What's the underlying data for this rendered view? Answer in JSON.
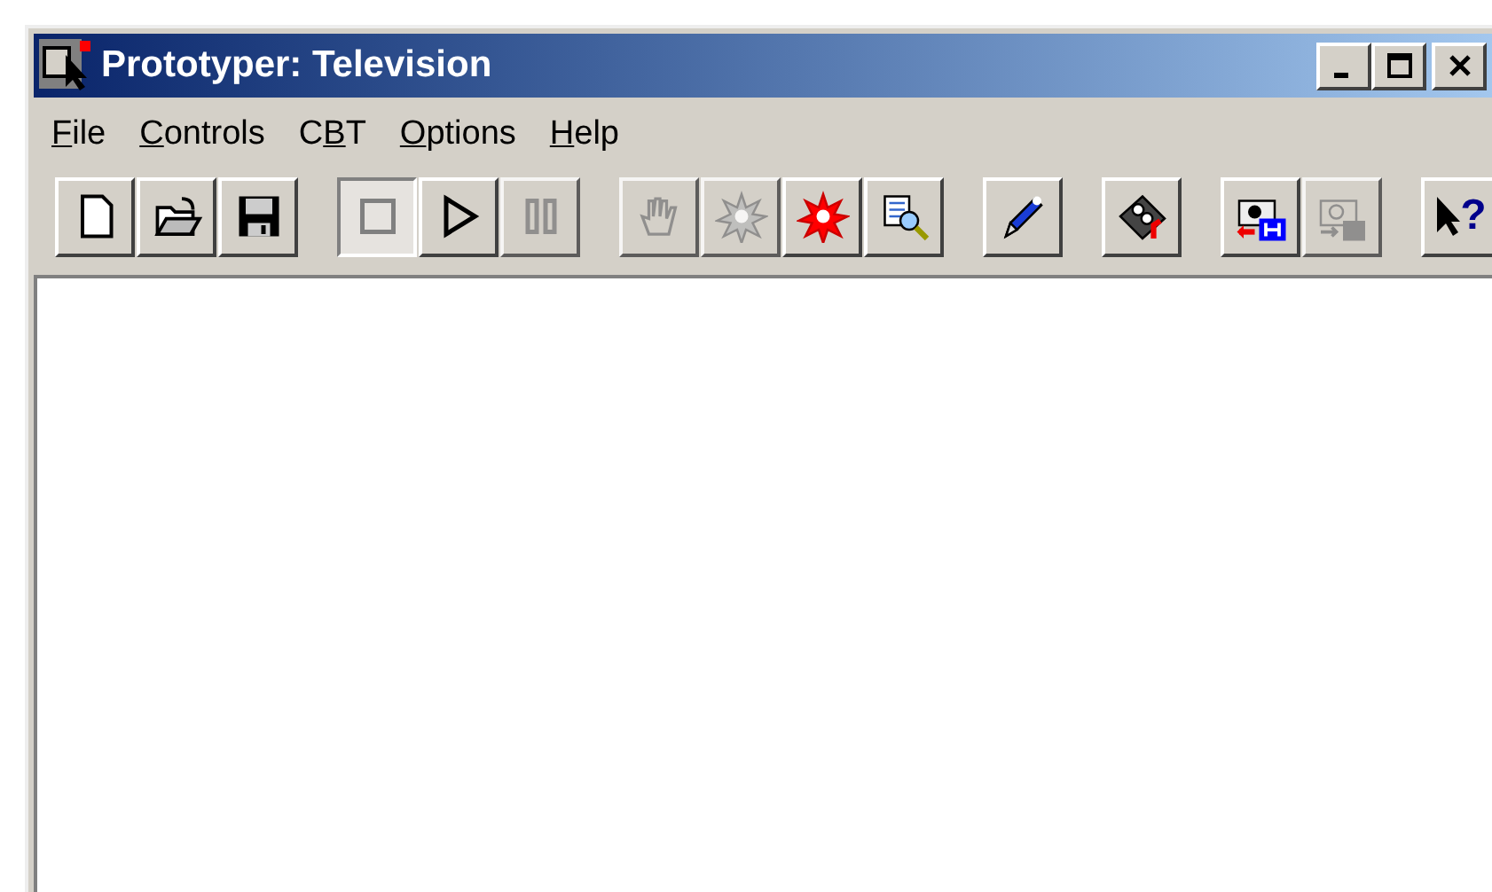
{
  "window": {
    "title": "Prototyper: Television",
    "controls": [
      {
        "kind": "minimize"
      },
      {
        "kind": "maximize"
      },
      {
        "kind": "close"
      }
    ]
  },
  "menu": [
    {
      "key": "F",
      "after": "ile"
    },
    {
      "key": "C",
      "after": "ontrols"
    },
    {
      "before": "C",
      "key": "B",
      "after": "T"
    },
    {
      "key": "O",
      "after": "ptions"
    },
    {
      "key": "H",
      "after": "elp"
    }
  ],
  "toolbar": [
    [
      {
        "kind": "new",
        "pressed": false,
        "disabled": false
      },
      {
        "kind": "open",
        "pressed": false,
        "disabled": false
      },
      {
        "kind": "save",
        "pressed": false,
        "disabled": false
      }
    ],
    [
      {
        "kind": "stop",
        "pressed": true,
        "disabled": false
      },
      {
        "kind": "play",
        "pressed": false,
        "disabled": false
      },
      {
        "kind": "pause",
        "pressed": false,
        "disabled": true
      }
    ],
    [
      {
        "kind": "hand",
        "pressed": false,
        "disabled": true
      },
      {
        "kind": "burst",
        "pressed": false,
        "disabled": true
      },
      {
        "kind": "burst",
        "pressed": false,
        "disabled": false
      },
      {
        "kind": "inspect",
        "pressed": false,
        "disabled": false
      }
    ],
    [
      {
        "kind": "pencil",
        "pressed": false,
        "disabled": false
      }
    ],
    [
      {
        "kind": "tape",
        "pressed": false,
        "disabled": false
      }
    ],
    [
      {
        "kind": "camera-save",
        "pressed": false,
        "disabled": false
      },
      {
        "kind": "camera-load",
        "pressed": false,
        "disabled": true
      }
    ],
    [
      {
        "kind": "help",
        "label": "?",
        "pressed": false,
        "disabled": false
      }
    ]
  ]
}
